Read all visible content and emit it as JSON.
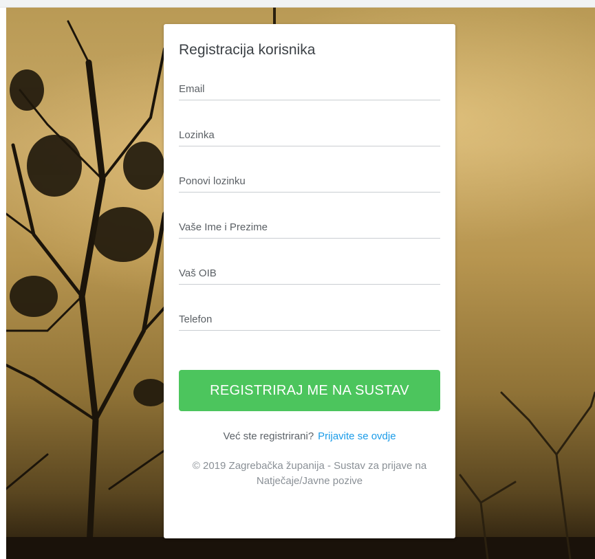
{
  "form": {
    "title": "Registracija korisnika",
    "fields": {
      "email": {
        "placeholder": "Email",
        "value": ""
      },
      "password": {
        "placeholder": "Lozinka",
        "value": ""
      },
      "password_repeat": {
        "placeholder": "Ponovi lozinku",
        "value": ""
      },
      "full_name": {
        "placeholder": "Vaše Ime i Prezime",
        "value": ""
      },
      "oib": {
        "placeholder": "Vaš OIB",
        "value": ""
      },
      "phone": {
        "placeholder": "Telefon",
        "value": ""
      }
    },
    "submit_label": "REGISTRIRAJ ME NA SUSTAV",
    "already_registered_text": "Već ste registrirani?",
    "login_link_text": "Prijavite se ovdje",
    "copyright_text": "© 2019 Zagrebačka županija - Sustav za prijave na Natječaje/Javne pozive"
  },
  "colors": {
    "button": "#4cc55d",
    "link": "#1a9be8"
  }
}
